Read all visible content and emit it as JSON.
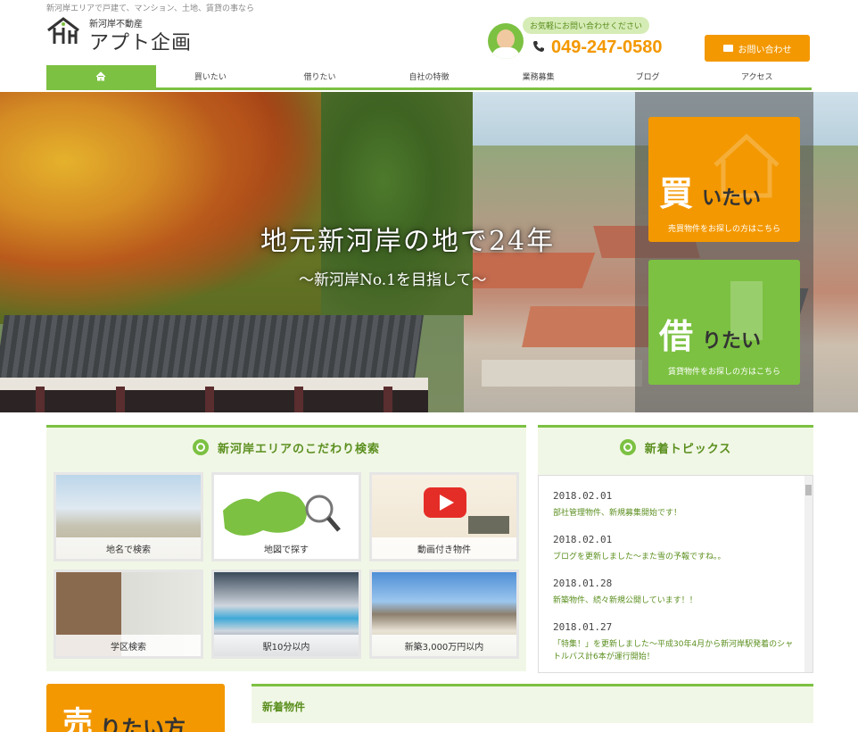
{
  "header": {
    "tagline": "新河岸エリアで戸建て、マンション、土地、賃貸の事なら",
    "logo_small": "新河岸不動産",
    "logo_big": "アプト企画",
    "contact_bubble": "お気軽にお問い合わせください",
    "phone": "049-247-0580",
    "contact_button": "お問い合わせ"
  },
  "nav": {
    "items": [
      "買いたい",
      "借りたい",
      "自社の特徴",
      "業務募集",
      "ブログ",
      "アクセス"
    ]
  },
  "hero": {
    "title": "地元新河岸の地で24年",
    "subtitle": "～新河岸No.1を目指して～"
  },
  "cta": {
    "buy_big": "買",
    "buy_rest": "いたい",
    "buy_note": "売買物件をお探しの方はこちら",
    "rent_big": "借",
    "rent_rest": "りたい",
    "rent_note": "賃貸物件をお探しの方はこちら"
  },
  "search": {
    "title": "新河岸エリアのこだわり検索",
    "tiles": [
      "地名で検索",
      "地図で探す",
      "動画付き物件",
      "学区検索",
      "駅10分以内",
      "新築3,000万円以内"
    ]
  },
  "topics": {
    "title": "新着トピックス",
    "items": [
      {
        "date": "2018.02.01",
        "text": "部社管理物件、新規募集開始です！"
      },
      {
        "date": "2018.02.01",
        "text": "ブログを更新しました～また雪の予報ですね。。"
      },
      {
        "date": "2018.01.28",
        "text": "新築物件、続々新規公開しています！！"
      },
      {
        "date": "2018.01.27",
        "text": "「特集！」を更新しました～平成30年4月から新河岸駅発着のシャトルバス計6本が運行開始！"
      }
    ]
  },
  "sell": {
    "big": "売",
    "rest": "りたい方"
  },
  "new_properties": {
    "title": "新着物件"
  },
  "colors": {
    "green": "#7cc142",
    "orange": "#f39800",
    "dark_green_text": "#5b8f1f"
  }
}
